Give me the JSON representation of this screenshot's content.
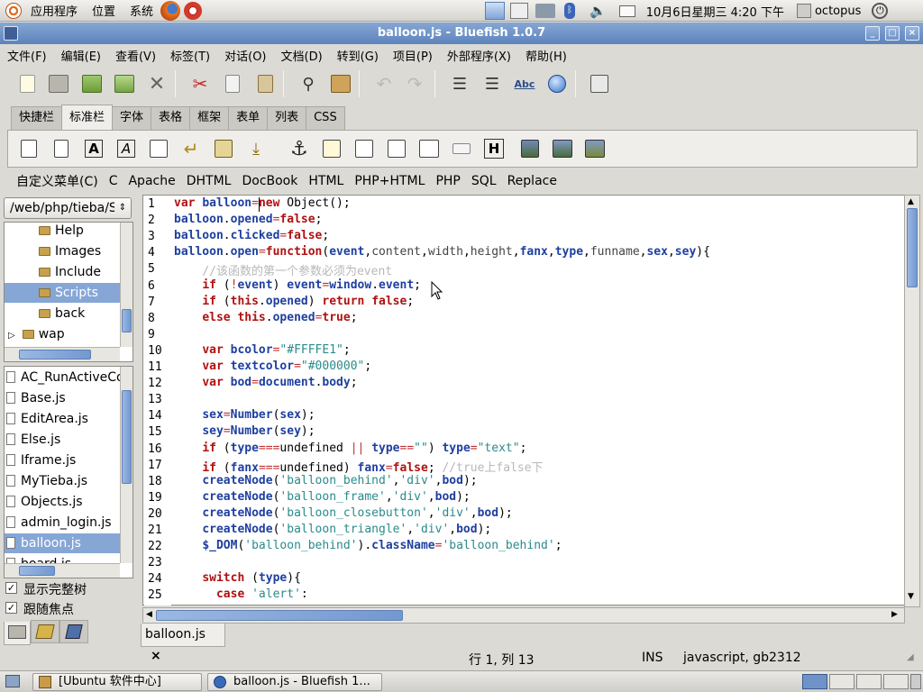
{
  "panel": {
    "menu_apps": "应用程序",
    "menu_places": "位置",
    "menu_system": "系统",
    "clock": "10月6日星期三 4:20 下午",
    "user": "octopus"
  },
  "window": {
    "title": "balloon.js - Bluefish 1.0.7"
  },
  "menubar": [
    "文件(F)",
    "编辑(E)",
    "查看(V)",
    "标签(T)",
    "对话(O)",
    "文档(D)",
    "转到(G)",
    "项目(P)",
    "外部程序(X)",
    "帮助(H)"
  ],
  "tabs": [
    "快捷栏",
    "标准栏",
    "字体",
    "表格",
    "框架",
    "表单",
    "列表",
    "CSS"
  ],
  "custom_menu": [
    "自定义菜单(C)",
    "C",
    "Apache",
    "DHTML",
    "DocBook",
    "HTML",
    "PHP+HTML",
    "PHP",
    "SQL",
    "Replace"
  ],
  "sidebar": {
    "path": "/web/php/tieba/Scripts",
    "dirs": [
      {
        "label": "Help",
        "selected": false,
        "indent": 1
      },
      {
        "label": "Images",
        "selected": false,
        "indent": 1
      },
      {
        "label": "Include",
        "selected": false,
        "indent": 1
      },
      {
        "label": "Scripts",
        "selected": true,
        "indent": 1
      },
      {
        "label": "back",
        "selected": false,
        "indent": 1
      },
      {
        "label": "wap",
        "selected": false,
        "indent": 0
      }
    ],
    "files": [
      "AC_RunActiveContent.js",
      "Base.js",
      "EditArea.js",
      "Else.js",
      "Iframe.js",
      "MyTieba.js",
      "Objects.js",
      "admin_login.js",
      "balloon.js",
      "board.js"
    ],
    "selected_file": "balloon.js",
    "opt_full_tree": "显示完整树",
    "opt_follow_focus": "跟随焦点"
  },
  "editor": {
    "lines": [
      "var balloon=new Object();",
      "balloon.opened=false;",
      "balloon.clicked=false;",
      "balloon.open=function(event,content,width,height,fanx,type,funname,sex,sey){",
      "    //该函数的第一个参数必须为event",
      "    if (!event) event=window.event;",
      "    if (this.opened) return false;",
      "    else this.opened=true;",
      "",
      "    var bcolor=\"#FFFFE1\";",
      "    var textcolor=\"#000000\";",
      "    var bod=document.body;",
      "",
      "    sex=Number(sex);",
      "    sey=Number(sey);",
      "    if (type===undefined || type==\"\") type=\"text\";",
      "    if (fanx===undefined) fanx=false; //true上false下",
      "    createNode('balloon_behind','div',bod);",
      "    createNode('balloon_frame','div',bod);",
      "    createNode('balloon_closebutton','div',bod);",
      "    createNode('balloon_triangle','div',bod);",
      "    $_DOM('balloon_behind').className='balloon_behind';",
      "",
      "    switch (type){",
      "      case 'alert':"
    ]
  },
  "doc_tab": {
    "label": "balloon.js",
    "close": "×"
  },
  "status": {
    "position": "行 1, 列 13",
    "mode": "INS",
    "type": "javascript, gb2312"
  },
  "taskbar": [
    {
      "label": "[Ubuntu 软件中心]"
    },
    {
      "label": "balloon.js - Bluefish 1..."
    }
  ]
}
